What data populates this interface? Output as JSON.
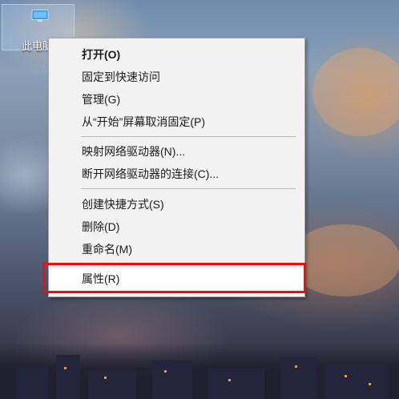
{
  "desktop": {
    "icon_label": "此电脑",
    "icon_name": "this-pc-icon"
  },
  "context_menu": {
    "groups": [
      [
        {
          "label": "打开(O)",
          "bold": true
        },
        {
          "label": "固定到快速访问"
        },
        {
          "label": "管理(G)"
        },
        {
          "label": "从“开始”屏幕取消固定(P)"
        }
      ],
      [
        {
          "label": "映射网络驱动器(N)..."
        },
        {
          "label": "断开网络驱动器的连接(C)..."
        }
      ],
      [
        {
          "label": "创建快捷方式(S)"
        },
        {
          "label": "删除(D)"
        },
        {
          "label": "重命名(M)"
        }
      ],
      [
        {
          "label": "属性(R)",
          "highlighted": true
        }
      ]
    ]
  },
  "annotation": {
    "highlight_color": "#e81010",
    "highlighted_item": "属性(R)"
  }
}
